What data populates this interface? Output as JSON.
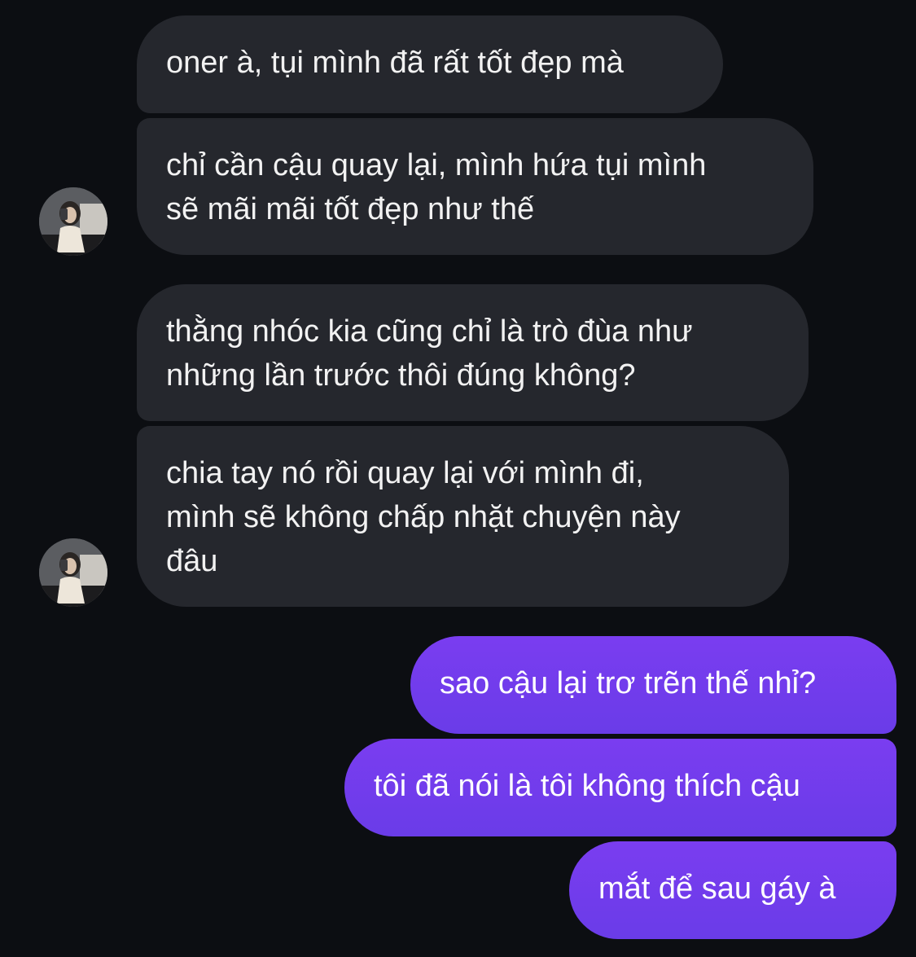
{
  "conversation": {
    "incoming": [
      {
        "text": "oner à, tụi mình đã rất tốt đẹp mà"
      },
      {
        "text": "chỉ cần cậu quay lại, mình hứa tụi mình\nsẽ mãi mãi tốt đẹp như thế"
      },
      {
        "text": "thằng nhóc kia cũng chỉ là trò đùa như\nnhững lần trước thôi đúng không?"
      },
      {
        "text": "chia tay nó rồi quay lại với mình đi,\nmình sẽ không chấp nhặt chuyện này\nđâu"
      }
    ],
    "outgoing": [
      {
        "text": "sao cậu lại trơ trẽn thế nhỉ?"
      },
      {
        "text": "tôi đã nói là tôi không thích cậu"
      },
      {
        "text": "mắt để sau gáy à"
      }
    ]
  },
  "colors": {
    "background": "#0c0e12",
    "incoming_bubble": "#25272d",
    "outgoing_bubble": "#7a3df0"
  },
  "icons": {
    "avatar": "contact-avatar-photo"
  }
}
